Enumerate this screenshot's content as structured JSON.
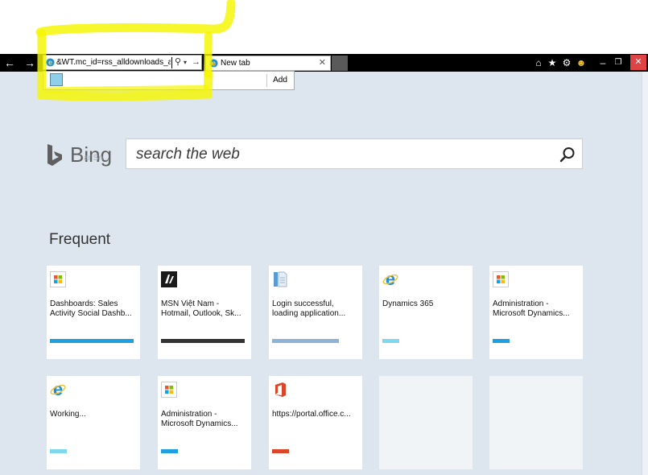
{
  "browser": {
    "address_text": "&WT.mc_id=rss_alldownloads_all",
    "tab_label": "New tab",
    "autocomplete_add_label": "Add"
  },
  "bing": {
    "wordmark": "Bing",
    "search_placeholder": "search the web",
    "ghost_text": "ar Sn..."
  },
  "frequent": {
    "heading": "Frequent",
    "tiles": [
      {
        "icon": "microsoft-logo-icon",
        "title": "Dashboards: Sales Activity Social Dashb...",
        "bar_color": "#1f9ee0",
        "bar_fill": 1.0
      },
      {
        "icon": "msn-butterfly-icon",
        "title": "MSN Việt Nam - Hotmail, Outlook, Sk...",
        "bar_color": "#333333",
        "bar_fill": 1.0
      },
      {
        "icon": "document-icon",
        "title": "Login successful, loading application...",
        "bar_color": "#8fb3d6",
        "bar_fill": 0.8
      },
      {
        "icon": "internet-explorer-icon",
        "title": "Dynamics 365",
        "bar_color": "#7fd8ee",
        "bar_fill": 0.2
      },
      {
        "icon": "microsoft-logo-icon",
        "title": "Administration - Microsoft Dynamics...",
        "bar_color": "#1f9ee0",
        "bar_fill": 0.2
      },
      {
        "icon": "internet-explorer-icon",
        "title": "Working...",
        "bar_color": "#7fd8ee",
        "bar_fill": 0.2
      },
      {
        "icon": "microsoft-logo-icon",
        "title": "Administration - Microsoft Dynamics...",
        "bar_color": "#1f9ee0",
        "bar_fill": 0.2
      },
      {
        "icon": "office-icon",
        "title": "https://portal.office.c...",
        "bar_color": "#d9462a",
        "bar_fill": 0.2
      },
      {
        "icon": "",
        "title": "",
        "bar_color": "",
        "bar_fill": 0
      },
      {
        "icon": "",
        "title": "",
        "bar_color": "",
        "bar_fill": 0
      }
    ]
  },
  "colors": {
    "annotation": "#f5f500",
    "page_bg": "#dde6ee",
    "close_button": "#e04343"
  }
}
